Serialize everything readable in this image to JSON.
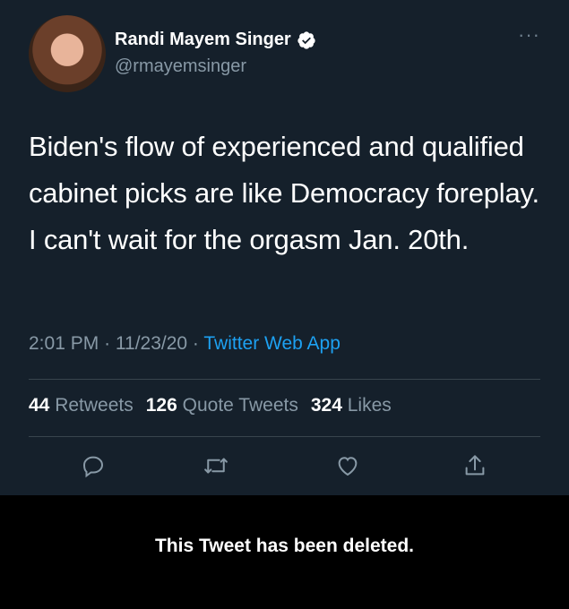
{
  "author": {
    "display_name": "Randi Mayem Singer",
    "handle": "@rmayemsinger",
    "verified": true
  },
  "tweet": {
    "text": "Biden's flow of experienced and qualified cabinet picks are like Democracy foreplay. I can't wait for the orgasm Jan. 20th.",
    "time": "2:01 PM",
    "date": "11/23/20",
    "source": "Twitter Web App"
  },
  "stats": {
    "retweets_count": "44",
    "retweets_label": "Retweets",
    "quote_count": "126",
    "quote_label": "Quote Tweets",
    "likes_count": "324",
    "likes_label": "Likes"
  },
  "notice": {
    "deleted": "This Tweet has been deleted."
  },
  "colors": {
    "background": "#15202b",
    "secondary_text": "#8899a6",
    "link": "#1da1f2",
    "notice_bar": "#000000"
  },
  "icons": [
    "more-icon",
    "verified-icon",
    "reply-icon",
    "retweet-icon",
    "like-icon",
    "share-icon"
  ]
}
